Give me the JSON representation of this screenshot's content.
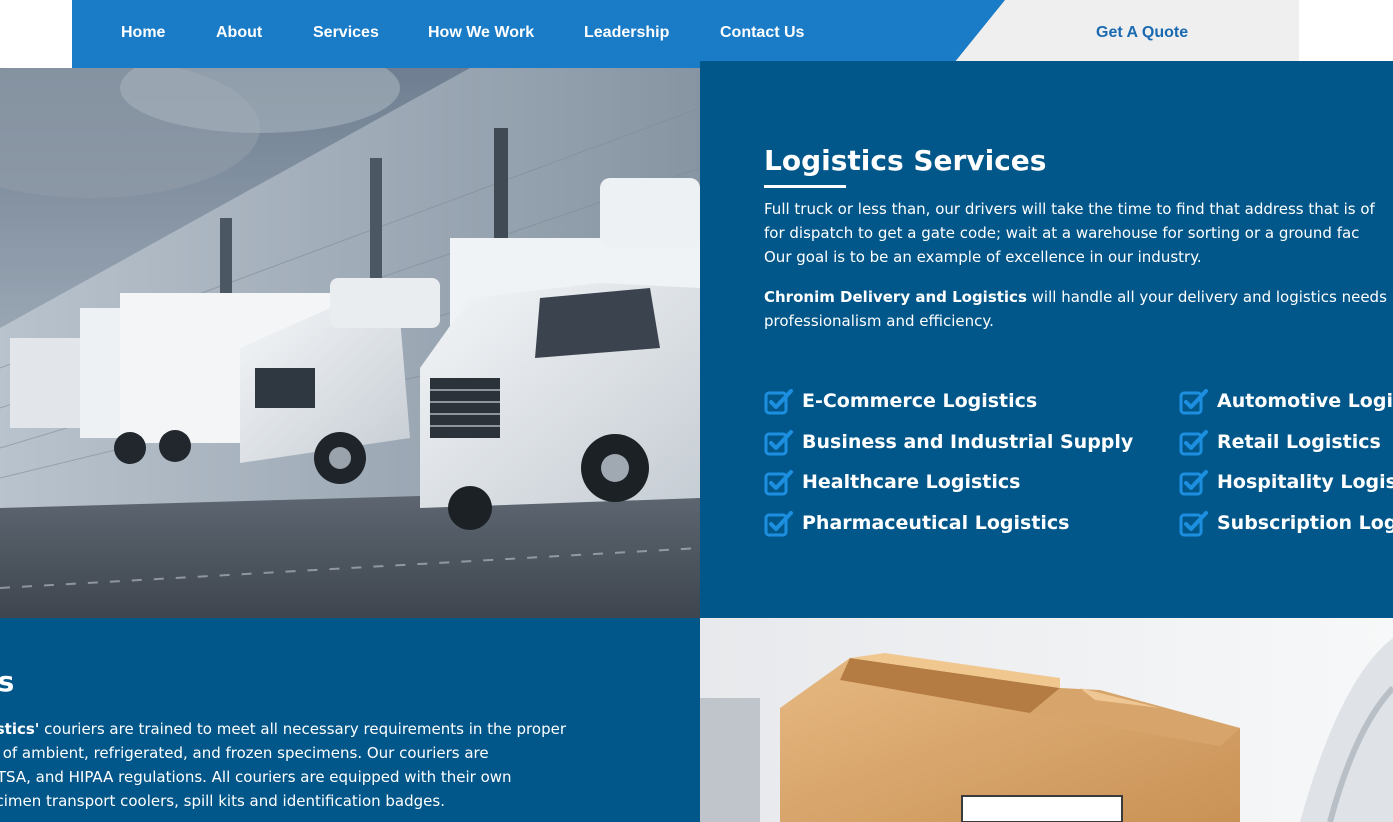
{
  "nav": {
    "items": [
      {
        "label": "Home"
      },
      {
        "label": "About"
      },
      {
        "label": "Services"
      },
      {
        "label": "How We Work"
      },
      {
        "label": "Leadership"
      },
      {
        "label": "Contact Us"
      }
    ],
    "quote_label": "Get A Quote"
  },
  "colors": {
    "nav_blue": "#1a7bc7",
    "panel_blue": "#02578a",
    "quote_bg": "#efefef",
    "quote_text": "#1a6ab1",
    "check_icon": "#1d8fe0"
  },
  "logistics": {
    "title": "Logistics Services",
    "para1_lines": [
      "Full truck or less than, our drivers will take the time to find that address that is of",
      "for dispatch to get a gate code; wait at a warehouse for sorting or a ground fac",
      "Our goal is to be an example of excellence in our industry."
    ],
    "para2_company": "Chronim Delivery and Logistics",
    "para2_rest_line1": " will handle all your delivery and logistics needs",
    "para2_line2": "professionalism and efficiency.",
    "list_left": [
      {
        "icon": "checkbox-check-icon",
        "label": "E-Commerce Logistics"
      },
      {
        "icon": "checkbox-check-icon",
        "label": "Business and Industrial Supply"
      },
      {
        "icon": "checkbox-check-icon",
        "label": "Healthcare Logistics"
      },
      {
        "icon": "checkbox-check-icon",
        "label": "Pharmaceutical Logistics"
      }
    ],
    "list_right": [
      {
        "icon": "checkbox-check-icon",
        "label": "Automotive Logist"
      },
      {
        "icon": "checkbox-check-icon",
        "label": "Retail Logistics"
      },
      {
        "icon": "checkbox-check-icon",
        "label": "Hospitality Logisti"
      },
      {
        "icon": "checkbox-check-icon",
        "label": "Subscription Logis"
      }
    ]
  },
  "courier": {
    "title": "ces",
    "para_line1_bold": "Logistics'",
    "para_line1_rest": " couriers are trained to meet all necessary requirements in the proper",
    "para_line2": "ation of ambient, refrigerated, and frozen specimens. Our couriers are",
    "para_line3": "ATA, TSA, and HIPAA regulations. All couriers are equipped with their own",
    "para_line4": "l specimen transport coolers, spill kits and identification badges."
  }
}
